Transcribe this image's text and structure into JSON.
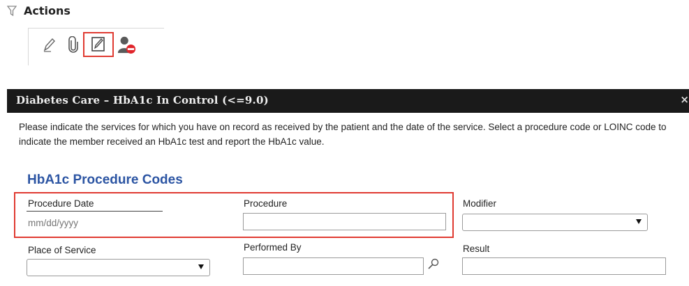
{
  "actions": {
    "title": "Actions",
    "icons": [
      "pencil-icon",
      "paperclip-icon",
      "edit-form-icon",
      "remove-user-icon"
    ]
  },
  "dialog": {
    "title": "Diabetes Care – HbA1c In Control (<=9.0)",
    "close_label": "×",
    "instructions": "Please indicate the services for which you have on record as received by the patient and the date of the service. Select a procedure code or LOINC code to indicate the member received an HbA1c test and report the HbA1c value.",
    "section_heading": "HbA1c Procedure Codes",
    "fields": {
      "procedure_date": {
        "label": "Procedure Date",
        "placeholder": "mm/dd/yyyy",
        "value": ""
      },
      "procedure": {
        "label": "Procedure",
        "value": ""
      },
      "modifier": {
        "label": "Modifier",
        "selected": ""
      },
      "place_of_service": {
        "label": "Place of Service",
        "selected": ""
      },
      "performed_by": {
        "label": "Performed By",
        "value": ""
      },
      "result": {
        "label": "Result",
        "value": ""
      }
    }
  },
  "colors": {
    "titlebar_bg": "#1a1a1a",
    "heading_blue": "#2c55a3",
    "highlight_red": "#e03a31"
  }
}
